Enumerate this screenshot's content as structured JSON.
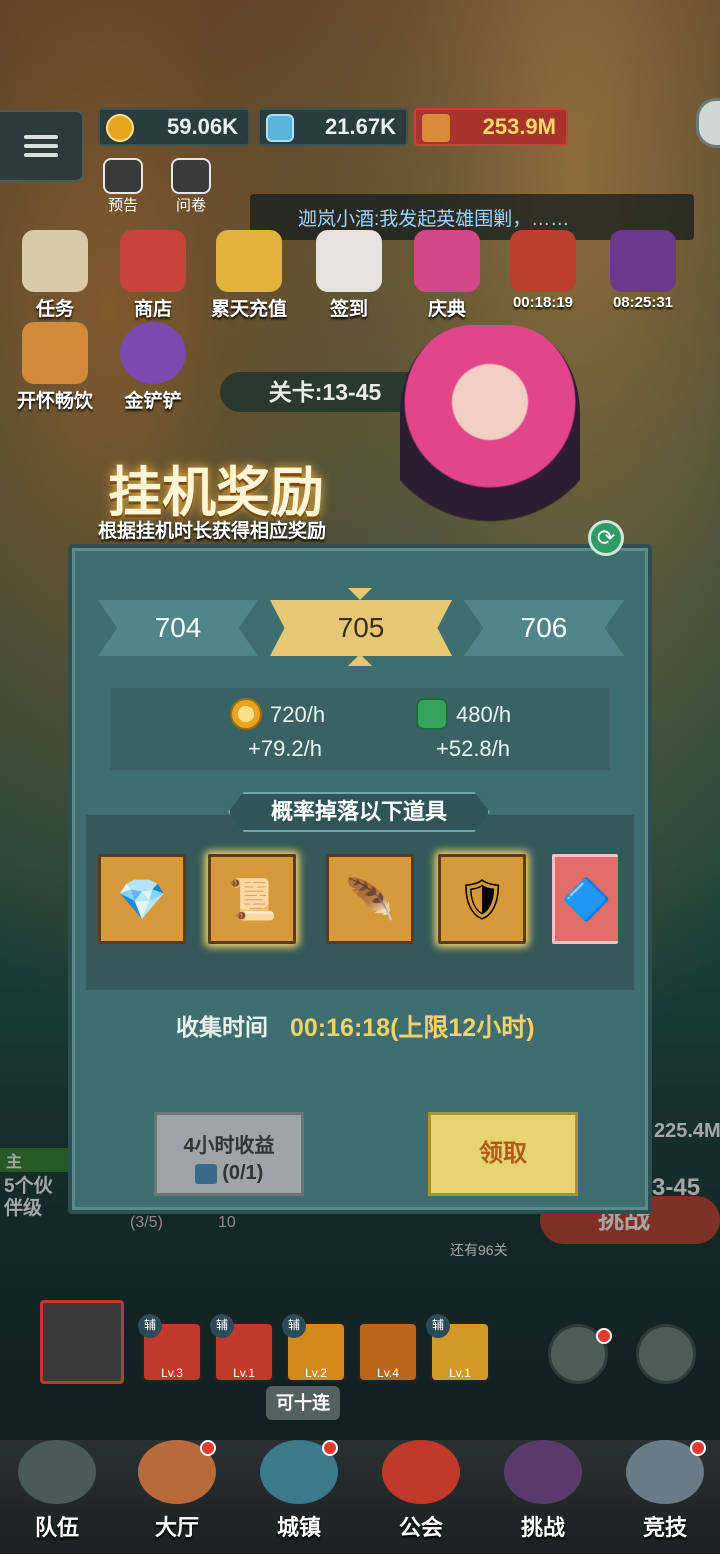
{
  "resources": {
    "gold": "59.06K",
    "gems": "21.67K",
    "power": "253.9M"
  },
  "top_icons": [
    {
      "label": "预告"
    },
    {
      "label": "问卷"
    }
  ],
  "chat": {
    "text": "迦岚小酒:我发起英雄围剿，……"
  },
  "activities": [
    {
      "label": "任务"
    },
    {
      "label": "商店"
    },
    {
      "label": "累天充值"
    },
    {
      "label": "签到"
    },
    {
      "label": "庆典"
    },
    {
      "label": "00:18:19"
    },
    {
      "label": "08:25:31"
    }
  ],
  "activities2": [
    {
      "label": "开怀畅饮"
    },
    {
      "label": "金铲铲"
    }
  ],
  "stage": {
    "label": "关卡:13-45"
  },
  "afk": {
    "title": "挂机奖励",
    "subtitle": "根据挂机时长获得相应奖励"
  },
  "levels": {
    "prev": "704",
    "current": "705",
    "next": "706"
  },
  "rates": {
    "gold": {
      "rate": "720/h",
      "bonus": "+79.2/h"
    },
    "gem": {
      "rate": "480/h",
      "bonus": "+52.8/h"
    }
  },
  "drops": {
    "title": "概率掉落以下道具",
    "items": [
      "gem-crystal",
      "scroll",
      "feather-quill",
      "shield-badge",
      "blue-crystal"
    ]
  },
  "collect": {
    "label": "收集时间",
    "value": "00:16:18(上限12小时)"
  },
  "buttons": {
    "four_hour_line1": "4小时收益",
    "four_hour_line2": "(0/1)",
    "claim": "领取"
  },
  "background_hints": {
    "left_text": "5个伙伴级",
    "left_tag": "主",
    "progress": "(3/5)",
    "progress_val": "10",
    "right_val": "225.4M",
    "right_stage": "3-45",
    "challenge": "挑战",
    "remaining": "还有96关"
  },
  "skills": [
    {
      "level": "Lv.3",
      "tag": "辅"
    },
    {
      "level": "Lv.1",
      "tag": "辅"
    },
    {
      "level": "Lv.2",
      "tag": "辅"
    },
    {
      "level": "Lv.4",
      "tag": ""
    },
    {
      "level": "Lv.1",
      "tag": "辅"
    }
  ],
  "ten_pull": "可十连",
  "nav": [
    {
      "label": "队伍"
    },
    {
      "label": "大厅"
    },
    {
      "label": "城镇"
    },
    {
      "label": "公会"
    },
    {
      "label": "挑战"
    },
    {
      "label": "竞技"
    }
  ],
  "colors": {
    "panel": "#3f6e70",
    "gold_text": "#f2d36a",
    "current_level": "#e6c874",
    "claim_button": "#e6d374"
  }
}
